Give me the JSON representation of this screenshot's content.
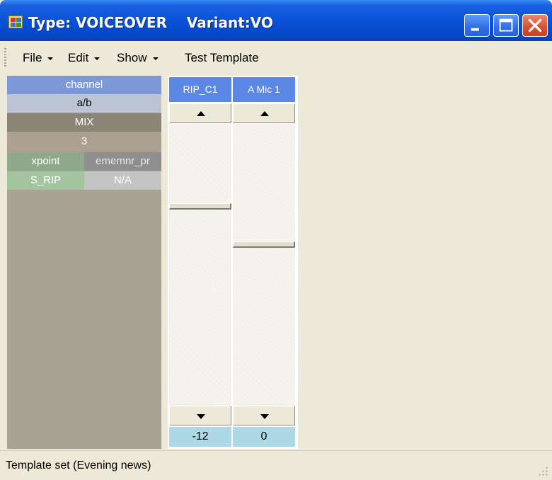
{
  "window": {
    "title": "Type: VOICEOVER    Variant:VO",
    "controls": {
      "minimize": "minimize-icon",
      "maximize": "maximize-icon",
      "close": "close-icon"
    }
  },
  "menu": {
    "items": [
      {
        "label": "File",
        "has_dropdown": true
      },
      {
        "label": "Edit",
        "has_dropdown": true
      },
      {
        "label": "Show",
        "has_dropdown": true
      },
      {
        "label": "Test Template",
        "has_dropdown": false
      }
    ]
  },
  "left_panel": {
    "channel_label": "channel",
    "ab": "a/b",
    "mix": "MIX",
    "number": "3",
    "xpoint": "xpoint",
    "ememnr": "ememnr_pr",
    "s_rip": "S_RIP",
    "na": "N/A",
    "colors": {
      "channel": "#7c98d6",
      "ab": "#bcc4d4",
      "mix": "#8c8476",
      "number": "#aca190",
      "xpoint": "#8eaa8a",
      "ememnr": "#8e8e8e",
      "s_rip": "#a4c4a0",
      "na": "#c4c4c4",
      "panel": "#a6a394"
    }
  },
  "channels": [
    {
      "name": "RIP_C1",
      "value": "-12",
      "level": 0.27
    },
    {
      "name": "A Mic 1",
      "value": "0",
      "level": 0.4
    }
  ],
  "statusbar": {
    "text": "Template set (Evening news)"
  },
  "colors": {
    "title_blue": "#0a52d8",
    "header_blue": "#5a88e4",
    "value_cell": "#add8e6",
    "background": "#ece9d8"
  }
}
